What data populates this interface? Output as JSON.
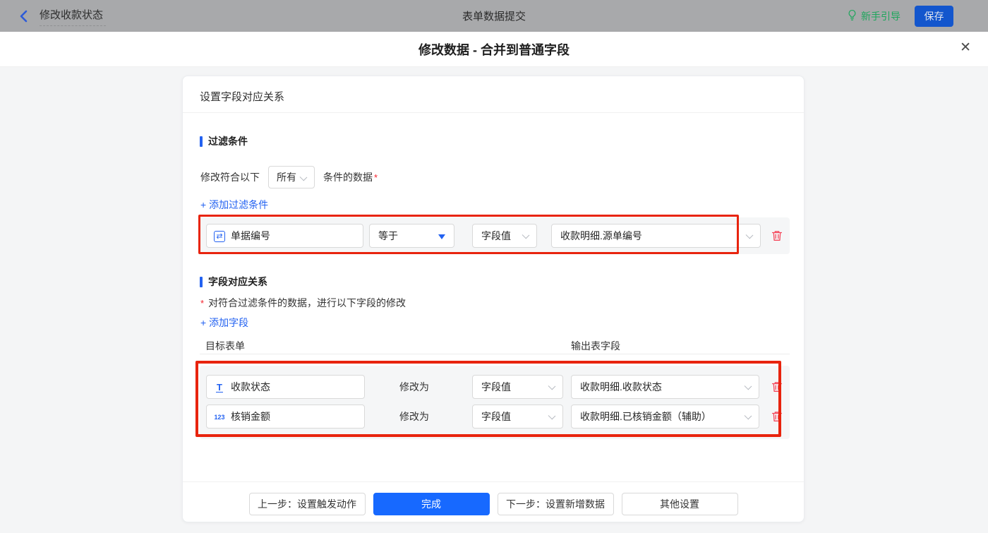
{
  "topbar": {
    "back_label": "修改收款状态",
    "center_title": "表单数据提交",
    "guide_label": "新手引导",
    "save_label": "保存"
  },
  "dialog": {
    "title": "修改数据 - 合并到普通字段",
    "close_glyph": "✕",
    "card_header": "设置字段对应关系",
    "filter_section": {
      "title": "过滤条件",
      "prefix_label": "修改符合以下",
      "match_value": "所有",
      "suffix_label": "条件的数据",
      "required_mark": "*",
      "add_link": "+ 添加过滤条件",
      "row": {
        "field_icon_glyph": "⇄",
        "field": "单据编号",
        "operator": "等于",
        "value_type": "字段值",
        "value": "收款明细.源单编号"
      }
    },
    "mapping_section": {
      "title": "字段对应关系",
      "required_mark": "*",
      "description": "对符合过滤条件的数据，进行以下字段的修改",
      "add_link": "+ 添加字段",
      "col_target": "目标表单",
      "col_output": "输出表字段",
      "rows": [
        {
          "icon_glyph": "T",
          "field": "收款状态",
          "modify_label": "修改为",
          "value_type": "字段值",
          "value": "收款明细.收款状态"
        },
        {
          "icon_glyph": "123",
          "field": "核销金额",
          "modify_label": "修改为",
          "value_type": "字段值",
          "value": "收款明细.已核销金额（辅助）"
        }
      ]
    },
    "footer": {
      "prev_label": "上一步：设置触发动作",
      "done_label": "完成",
      "next_label": "下一步：设置新增数据",
      "other_label": "其他设置"
    }
  },
  "colors": {
    "accent_blue": "#2362f1",
    "primary_button_blue": "#1769ff",
    "save_button_blue": "#1356cd",
    "guide_green": "#1ea65c",
    "danger_red": "#f5475b",
    "annotation_red": "#e8240e",
    "topbar_gray": "#a8a9ab"
  }
}
